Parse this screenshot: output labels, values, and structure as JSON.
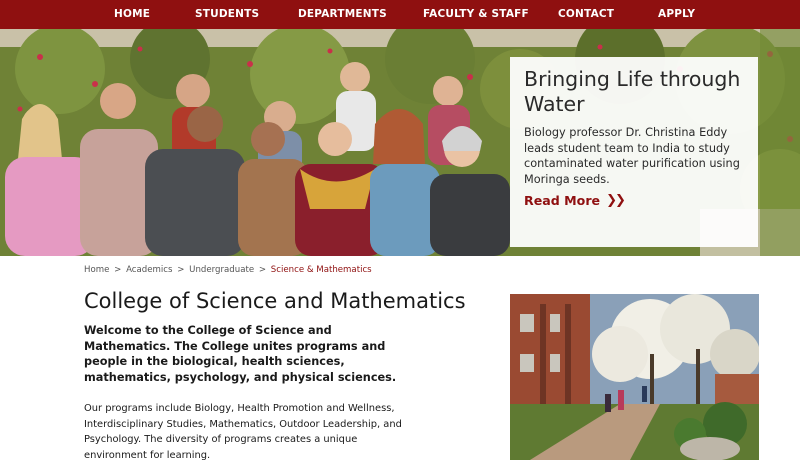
{
  "nav": {
    "items": [
      {
        "label": "HOME"
      },
      {
        "label": "STUDENTS"
      },
      {
        "label": "DEPARTMENTS"
      },
      {
        "label": "FACULTY & STAFF"
      },
      {
        "label": "CONTACT"
      },
      {
        "label": "APPLY"
      }
    ]
  },
  "hero": {
    "title": "Bringing Life through Water",
    "body": "Biology professor Dr. Christina Eddy leads student team to India to study contaminated water purification using Moringa seeds.",
    "cta_label": "Read More",
    "cta_icon": "double-chevron-right-icon"
  },
  "breadcrumb": {
    "items": [
      "Home",
      "Academics",
      "Undergraduate"
    ],
    "separator": ">",
    "current": "Science & Mathematics"
  },
  "main": {
    "title": "College of Science and Mathematics",
    "intro": "Welcome to the College of Science and Mathematics. The College unites programs and people in the biological, health sciences, mathematics, psychology, and physical sciences.",
    "body": "Our programs include Biology, Health Promotion and Wellness, Interdisciplinary Studies, Mathematics, Outdoor Leadership, and Psychology. The diversity of programs creates a unique environment for learning."
  },
  "colors": {
    "brand": "#8f1010",
    "nav_text": "#ffffff",
    "text": "#1a1a1a"
  }
}
